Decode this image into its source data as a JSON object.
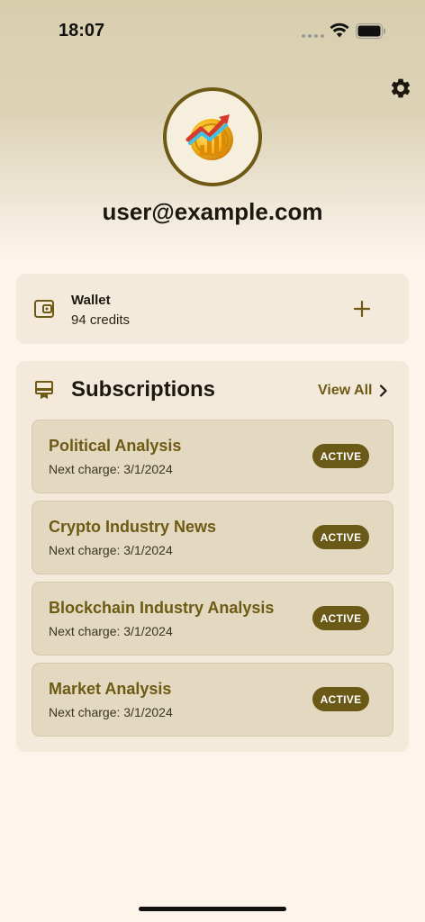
{
  "status_bar": {
    "time": "18:07"
  },
  "profile": {
    "email": "user@example.com"
  },
  "wallet": {
    "title": "Wallet",
    "credits": "94 credits"
  },
  "subscriptions": {
    "title": "Subscriptions",
    "view_all": "View All",
    "items": [
      {
        "name": "Political Analysis",
        "charge": "Next charge: 3/1/2024",
        "status": "ACTIVE"
      },
      {
        "name": "Crypto Industry News",
        "charge": "Next charge: 3/1/2024",
        "status": "ACTIVE"
      },
      {
        "name": "Blockchain Industry Analysis",
        "charge": "Next charge: 3/1/2024",
        "status": "ACTIVE"
      },
      {
        "name": "Market Analysis",
        "charge": "Next charge: 3/1/2024",
        "status": "ACTIVE"
      }
    ]
  },
  "icons": {
    "settings": "gear-icon",
    "wallet": "wallet-icon",
    "add": "plus-icon",
    "subscriptions": "card-membership-icon",
    "view_all": "chevron-right-icon"
  },
  "colors": {
    "accent": "#6e5a14",
    "badge": "#6b5a17",
    "background": "#fdf5eb",
    "card": "#f3eadb",
    "item": "#e3d9c0"
  }
}
